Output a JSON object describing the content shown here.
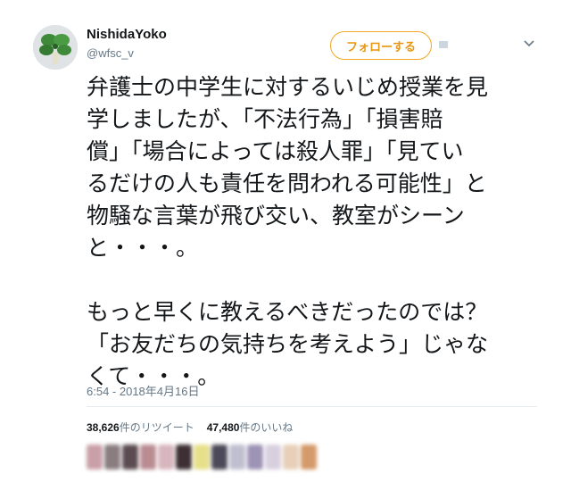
{
  "tweet": {
    "display_name": "NishidaYoko",
    "handle": "@wfsc_v",
    "follow_label": "フォローする",
    "text": "弁護士の中学生に対するいじめ授業を見\n学しましたが、「不法行為」「損害賠\n償」「場合によっては殺人罪」「見てい\nるだけの人も責任を問われる可能性」と\n物騒な言葉が飛び交い、教室がシーン\nと・・・。\n\nもっと早くに教えるべきだったのでは？\n「お友だちの気持ちを考えよう」じゃな\nくて・・・。",
    "timestamp": "6:54 - 2018年4月16日",
    "retweets": {
      "count": "38,626",
      "label": "件のリツイート"
    },
    "likes": {
      "count": "47,480",
      "label": "件のいいね"
    },
    "liker_avatar_colors": [
      "#c9a0a8",
      "#8a7d80",
      "#5b4c52",
      "#b98c92",
      "#d7b6bd",
      "#3d3034",
      "#e7e08a",
      "#4c4a58",
      "#bfbfcf",
      "#9d93b5",
      "#d8d0de",
      "#e7cfb9",
      "#d49a6a"
    ]
  },
  "colors": {
    "accent": "#f5a623",
    "text": "#14171a",
    "muted": "#657786"
  },
  "icons": {
    "avatar": "green-clover-character-icon",
    "caret": "chevron-down-icon"
  }
}
